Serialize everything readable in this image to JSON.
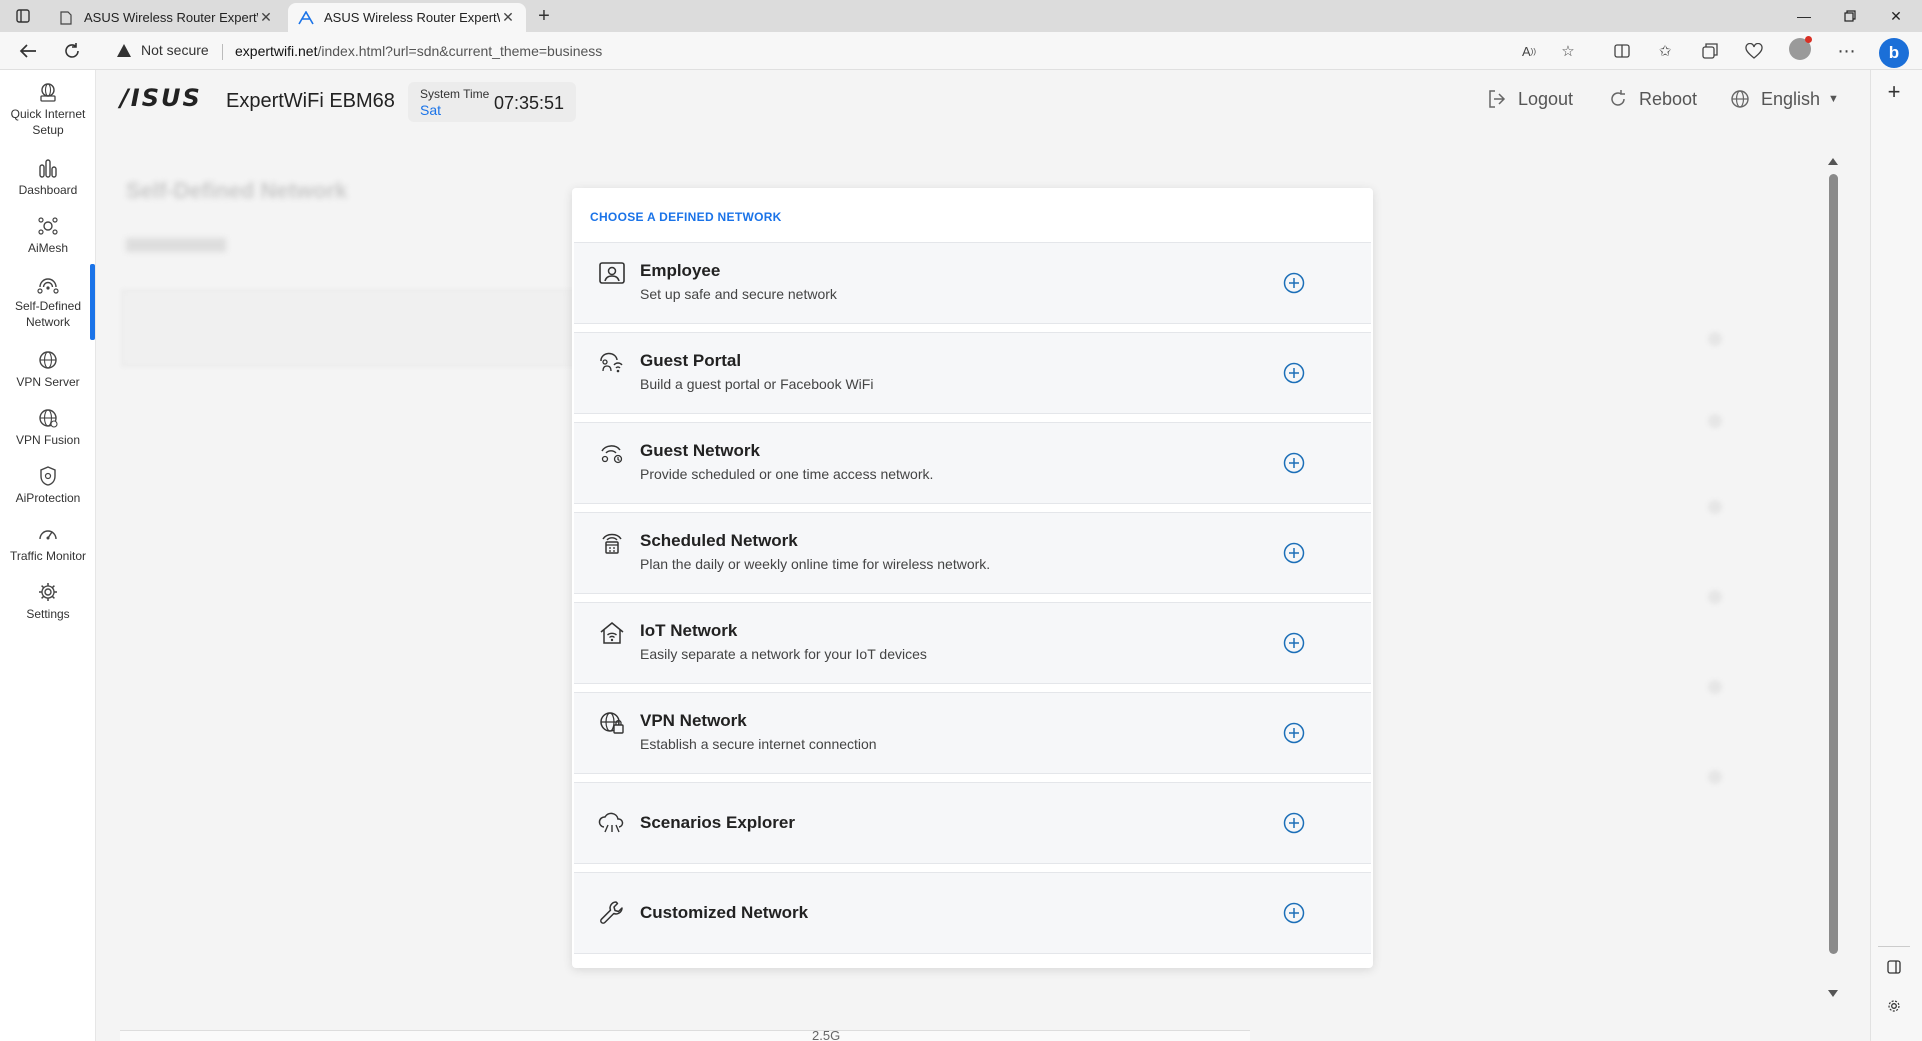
{
  "browser": {
    "tabs": [
      {
        "title": "ASUS Wireless Router ExpertWiF",
        "active": false
      },
      {
        "title": "ASUS Wireless Router ExpertWiF",
        "active": true
      }
    ],
    "security_label": "Not secure",
    "url_host": "expertwifi.net",
    "url_path": "/index.html?url=sdn&current_theme=business",
    "copilot_label": "b"
  },
  "header": {
    "brand": "/ISUS",
    "model": "ExpertWiFi EBM68",
    "system_time_label": "System Time",
    "system_day": "Sat",
    "system_clock": "07:35:51",
    "logout_label": "Logout",
    "reboot_label": "Reboot",
    "language_label": "English"
  },
  "sidebar": {
    "items": [
      {
        "label": "Quick Internet\nSetup",
        "icon": "globe-setup-icon"
      },
      {
        "label": "Dashboard",
        "icon": "bars-icon"
      },
      {
        "label": "AiMesh",
        "icon": "mesh-icon"
      },
      {
        "label": "Self-Defined\nNetwork",
        "icon": "sdn-icon"
      },
      {
        "label": "VPN Server",
        "icon": "globe-icon"
      },
      {
        "label": "VPN Fusion",
        "icon": "globe-icon"
      },
      {
        "label": "AiProtection",
        "icon": "shield-icon"
      },
      {
        "label": "Traffic Monitor",
        "icon": "gauge-icon"
      },
      {
        "label": "Settings",
        "icon": "gear-icon"
      }
    ],
    "active_index": 3
  },
  "background": {
    "page_title": "Self-Defined Network",
    "bottom_text": "2.5G"
  },
  "modal": {
    "title": "CHOOSE A DEFINED NETWORK",
    "options": [
      {
        "name": "Employee",
        "desc": "Set up safe and secure network",
        "icon": "employee-badge-icon"
      },
      {
        "name": "Guest Portal",
        "desc": "Build a guest portal or Facebook WiFi",
        "icon": "guest-portal-icon"
      },
      {
        "name": "Guest Network",
        "desc": "Provide scheduled or one time access network.",
        "icon": "guest-network-icon"
      },
      {
        "name": "Scheduled Network",
        "desc": "Plan the daily or weekly online time for wireless network.",
        "icon": "calendar-wifi-icon"
      },
      {
        "name": "IoT Network",
        "desc": "Easily separate a network for your IoT devices",
        "icon": "iot-house-icon"
      },
      {
        "name": "VPN Network",
        "desc": "Establish a secure internet connection",
        "icon": "vpn-globe-icon"
      },
      {
        "name": "Scenarios Explorer",
        "desc": "",
        "icon": "scenario-cloud-icon"
      },
      {
        "name": "Customized Network",
        "desc": "",
        "icon": "wrench-icon"
      }
    ]
  },
  "colors": {
    "accent": "#1a73e8",
    "plus_icon": "#1c6fb8"
  }
}
